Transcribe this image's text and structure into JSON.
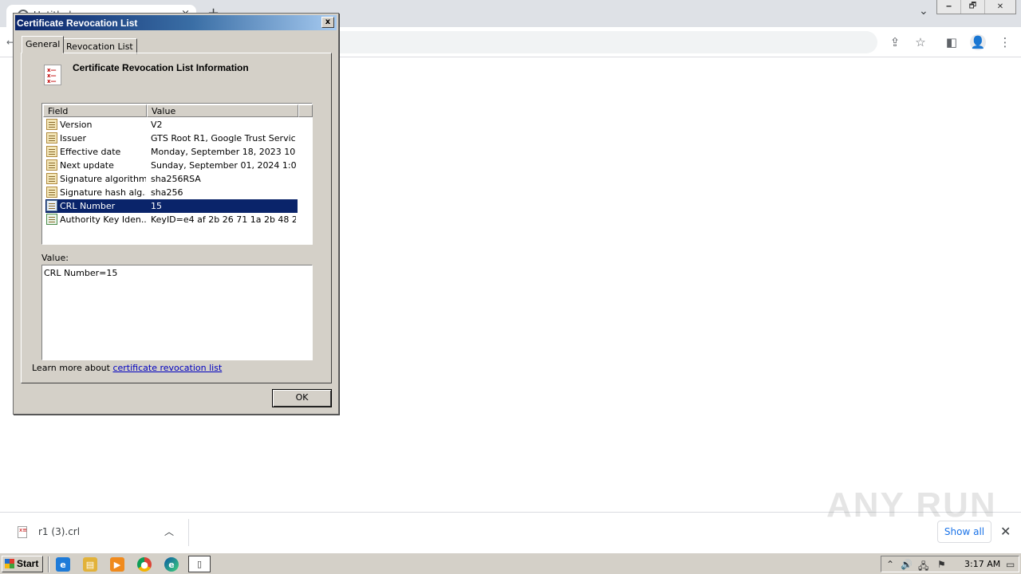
{
  "browser": {
    "tab_title": "Untitled",
    "tab_close": "×",
    "new_tab": "+",
    "tab_search": "⌄",
    "minimize": "🗕",
    "restore": "🗗",
    "close": "✕"
  },
  "dialog": {
    "title": "Certificate Revocation List",
    "close_glyph": "x",
    "tabs": [
      "General",
      "Revocation List"
    ],
    "header": "Certificate Revocation List Information",
    "columns": [
      "Field",
      "Value"
    ],
    "rows": [
      {
        "field": "Version",
        "value": "V2"
      },
      {
        "field": "Issuer",
        "value": "GTS Root R1, Google Trust Servic..."
      },
      {
        "field": "Effective date",
        "value": "Monday, September 18, 2023 10:..."
      },
      {
        "field": "Next update",
        "value": "Sunday, September 01, 2024 1:00..."
      },
      {
        "field": "Signature algorithm",
        "value": "sha256RSA"
      },
      {
        "field": "Signature hash alg...",
        "value": "sha256"
      },
      {
        "field": "CRL Number",
        "value": "15"
      },
      {
        "field": "Authority Key Iden...",
        "value": "KeyID=e4 af 2b 26 71 1a 2b 48 2..."
      }
    ],
    "selected_row": 6,
    "value_label": "Value:",
    "value_text": "CRL Number=15",
    "learn_more": "Learn more about",
    "learn_link": "certificate revocation list",
    "ok": "OK"
  },
  "download": {
    "file_name": "r1 (3).crl",
    "show_all": "Show all",
    "watermark": "ANY RUN"
  },
  "taskbar": {
    "start": "Start",
    "clock": "3:17 AM"
  }
}
